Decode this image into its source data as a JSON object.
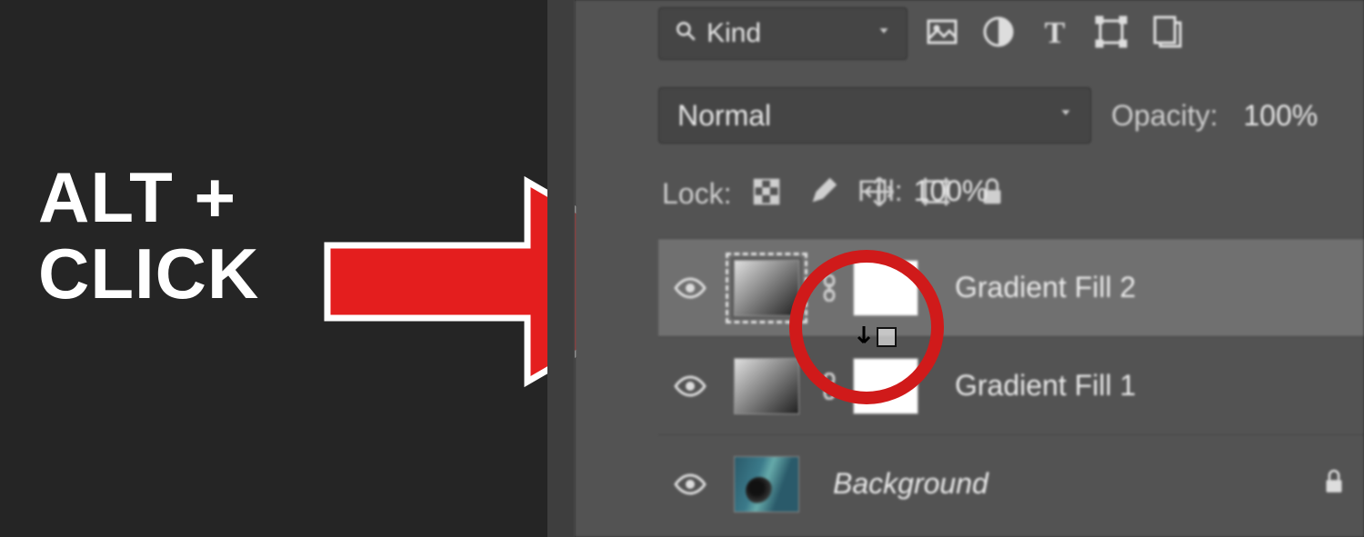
{
  "caption": {
    "line1": "ALT +",
    "line2": "CLICK"
  },
  "filter": {
    "label": "Kind"
  },
  "blend": {
    "mode": "Normal",
    "opacity_label": "Opacity:",
    "opacity_value": "100%"
  },
  "lock": {
    "label": "Lock:",
    "fill_label": "Fill:",
    "fill_value": "100%"
  },
  "layers": [
    {
      "name": "Gradient Fill 2",
      "type": "adjustment",
      "selected": true
    },
    {
      "name": "Gradient Fill 1",
      "type": "adjustment",
      "selected": false
    },
    {
      "name": "Background",
      "type": "image",
      "locked": true,
      "selected": false
    }
  ],
  "annotation": {
    "shape": "circle",
    "target": "between-layers-clip-cursor",
    "color": "#d01a1a"
  }
}
